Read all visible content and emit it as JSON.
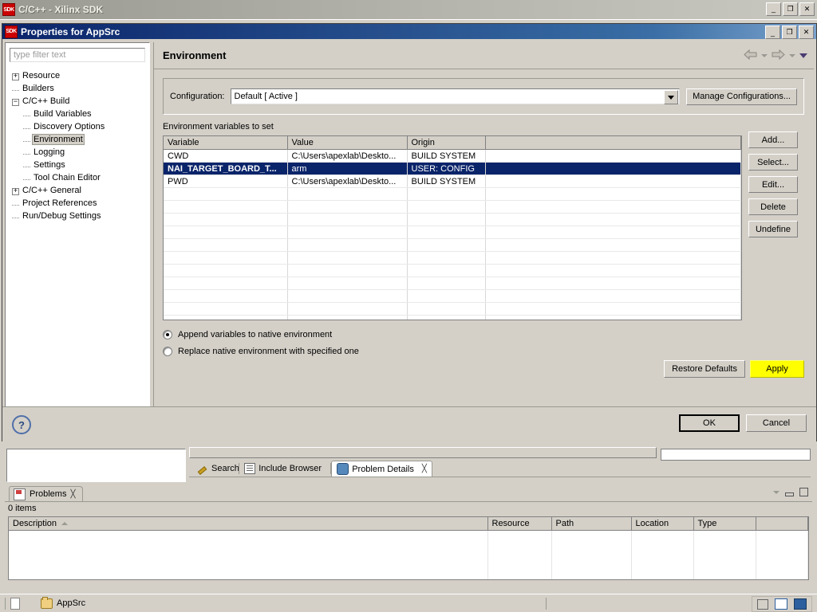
{
  "app": {
    "title": "C/C++ - Xilinx SDK",
    "badge": "SDK",
    "window_buttons": {
      "minimize": "_",
      "maximize": "❐",
      "close": "✕"
    }
  },
  "dialog": {
    "title": "Properties for AppSrc",
    "badge": "SDK",
    "window_buttons": {
      "minimize": "_",
      "maximize": "❐",
      "close": "✕"
    },
    "filter": {
      "placeholder": "type filter text",
      "value": ""
    },
    "tree": [
      {
        "label": "Resource",
        "level": 1,
        "twisty": "+"
      },
      {
        "label": "Builders",
        "level": 1,
        "twisty": ""
      },
      {
        "label": "C/C++ Build",
        "level": 1,
        "twisty": "-"
      },
      {
        "label": "Build Variables",
        "level": 2,
        "twisty": ""
      },
      {
        "label": "Discovery Options",
        "level": 2,
        "twisty": ""
      },
      {
        "label": "Environment",
        "level": 2,
        "twisty": "",
        "selected": true
      },
      {
        "label": "Logging",
        "level": 2,
        "twisty": ""
      },
      {
        "label": "Settings",
        "level": 2,
        "twisty": ""
      },
      {
        "label": "Tool Chain Editor",
        "level": 2,
        "twisty": ""
      },
      {
        "label": "C/C++ General",
        "level": 1,
        "twisty": "+"
      },
      {
        "label": "Project References",
        "level": 1,
        "twisty": ""
      },
      {
        "label": "Run/Debug Settings",
        "level": 1,
        "twisty": ""
      }
    ],
    "page_title": "Environment",
    "configuration": {
      "label": "Configuration:",
      "value": "Default  [ Active ]",
      "manage_button": "Manage Configurations..."
    },
    "table": {
      "caption": "Environment variables to set",
      "columns": [
        "Variable",
        "Value",
        "Origin",
        ""
      ],
      "rows": [
        {
          "variable": "CWD",
          "value": "C:\\Users\\apexlab\\Deskto...",
          "origin": "BUILD SYSTEM",
          "selected": false
        },
        {
          "variable": "NAI_TARGET_BOARD_T...",
          "value": "arm",
          "origin": "USER: CONFIG",
          "selected": true
        },
        {
          "variable": "PWD",
          "value": "C:\\Users\\apexlab\\Deskto...",
          "origin": "BUILD SYSTEM",
          "selected": false
        }
      ],
      "empty_row_count": 11
    },
    "side_buttons": [
      "Add...",
      "Select...",
      "Edit...",
      "Delete",
      "Undefine"
    ],
    "radios": [
      {
        "label": "Append variables to native environment",
        "checked": true
      },
      {
        "label": "Replace native environment with specified one",
        "checked": false
      }
    ],
    "restore_defaults": "Restore Defaults",
    "apply": "Apply",
    "apply_highlight_color": "#ffff00",
    "help": "?",
    "ok": "OK",
    "cancel": "Cancel"
  },
  "views": {
    "editor_tabs": [
      {
        "label": "Search",
        "icon": "search-icon",
        "active": false,
        "closable": false
      },
      {
        "label": "Include Browser",
        "icon": "list-icon",
        "active": false,
        "closable": false
      },
      {
        "label": "Problem Details",
        "icon": "bug-icon",
        "active": true,
        "closable": true
      }
    ],
    "problems": {
      "tab_label": "Problems",
      "tab_icon": "problems-icon",
      "items_count": "0 items",
      "columns": [
        "Description",
        "Resource",
        "Path",
        "Location",
        "Type",
        ""
      ],
      "sort_column": "Description",
      "sort_direction": "ascending",
      "rows": []
    }
  },
  "statusbar": {
    "selection": "AppSrc",
    "selection_icon": "folder-icon"
  }
}
